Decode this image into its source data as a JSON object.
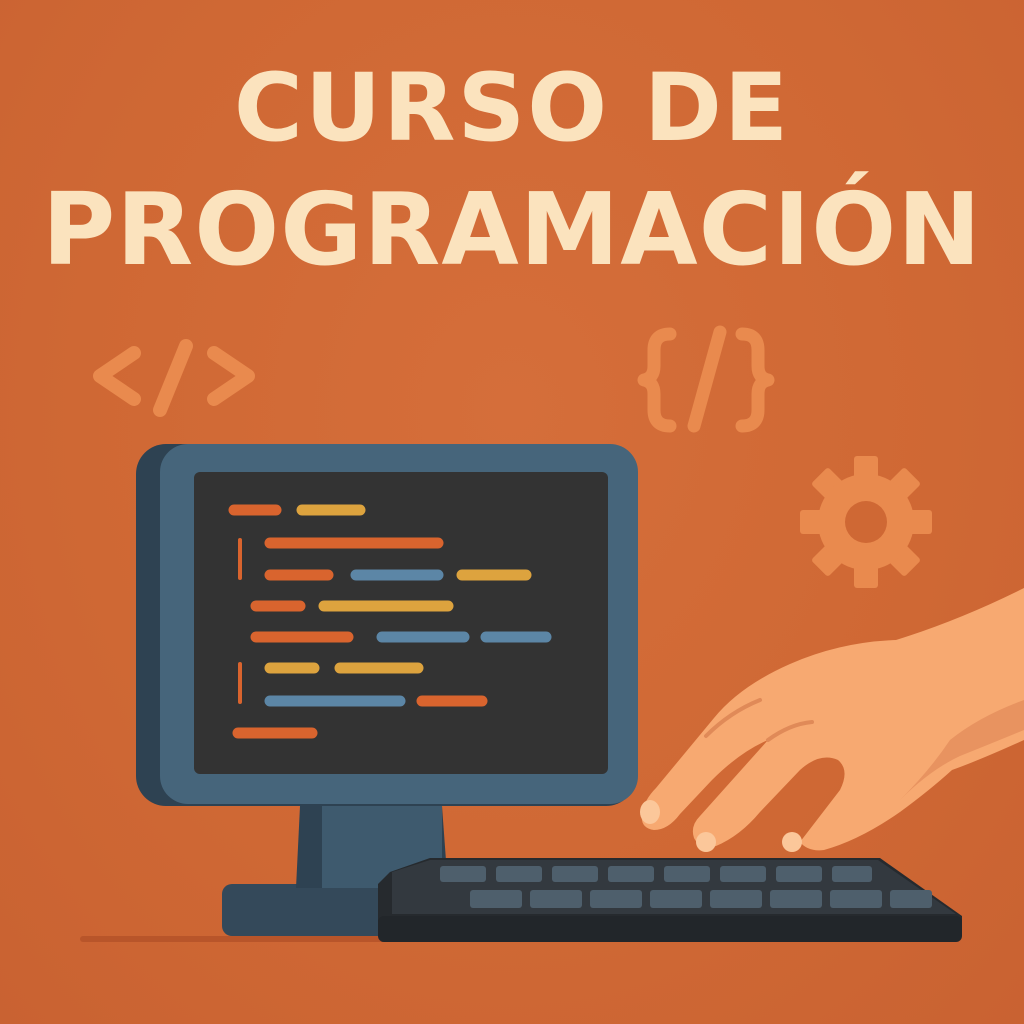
{
  "title": {
    "line1": "CURSO DE",
    "line2": "PROGRAMACIÓN"
  },
  "decorations": {
    "tag_symbol": "</>",
    "braces_symbol": "{/}",
    "gear": "gear-icon"
  },
  "colors": {
    "background": "#D06936",
    "title_text": "#FBE3BE",
    "monitor_frame": "#3E5A6E",
    "screen": "#343434",
    "code_orange": "#D9642E",
    "code_yellow": "#DDA33E",
    "code_blue": "#5C86A6",
    "skin": "#F7A971",
    "keyboard": "#2E3338"
  }
}
